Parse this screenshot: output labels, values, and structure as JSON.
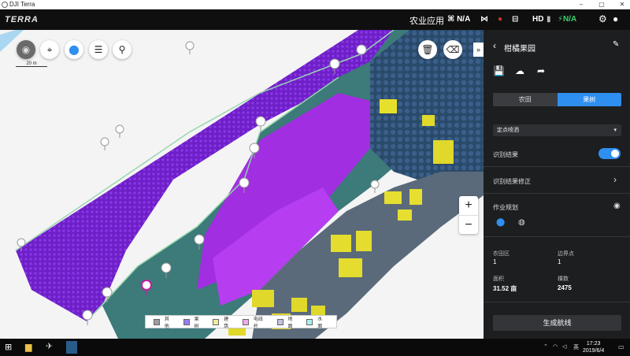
{
  "window": {
    "title": "DJI Terra",
    "min": "–",
    "max": "▢",
    "close": "✕"
  },
  "topbar": {
    "brand": "TERRA",
    "mode": "农业应用",
    "status": [
      {
        "icon": "rtk-icon",
        "glyph": "⌘",
        "text": "N/A",
        "color": "#ffffff"
      },
      {
        "icon": "satellite-icon",
        "glyph": "⋈",
        "text": "",
        "color": "#ffffff"
      },
      {
        "icon": "record-icon",
        "glyph": "●",
        "text": "",
        "color": "#c0392b"
      },
      {
        "icon": "remote-controller-icon",
        "glyph": "⊟",
        "text": "",
        "color": "#ffffff"
      },
      {
        "icon": "hd-signal-icon",
        "glyph": "",
        "text": "HD",
        "color": "#ffffff"
      },
      {
        "icon": "battery-icon",
        "glyph": "",
        "text": "N/A",
        "color": "#3ad06b"
      }
    ]
  },
  "map": {
    "scale_label": "20 m",
    "legend": [
      {
        "label": "其他",
        "color": "#9e9e9e"
      },
      {
        "label": "果树",
        "color": "#9a7cf0"
      },
      {
        "label": "建筑",
        "color": "#f2eaa0"
      },
      {
        "label": "电线杆",
        "color": "#f0a8f0"
      },
      {
        "label": "地面",
        "color": "#c0c0e0"
      },
      {
        "label": "水面",
        "color": "#a8f0f0"
      }
    ],
    "zoom_in": "+",
    "zoom_out": "−",
    "collapse": "»"
  },
  "panel": {
    "back": "‹",
    "title": "柑橘果园",
    "tabs": [
      "农田",
      "果树"
    ],
    "active_tab": 1,
    "spray_mode": "定点喷洒",
    "recognition_result": "识别结果",
    "recognition_fix": "识别结果修正",
    "work_plan": "作业规划",
    "stats": [
      {
        "label": "农田区",
        "value": "1"
      },
      {
        "label": "边界点",
        "value": "1"
      },
      {
        "label": "面积",
        "value": "31.52 亩"
      },
      {
        "label": "棵数",
        "value": "2475"
      }
    ],
    "generate_route": "生成航线"
  },
  "taskbar": {
    "tray_lang": "英",
    "time": "17:23",
    "date": "2019/6/4"
  }
}
